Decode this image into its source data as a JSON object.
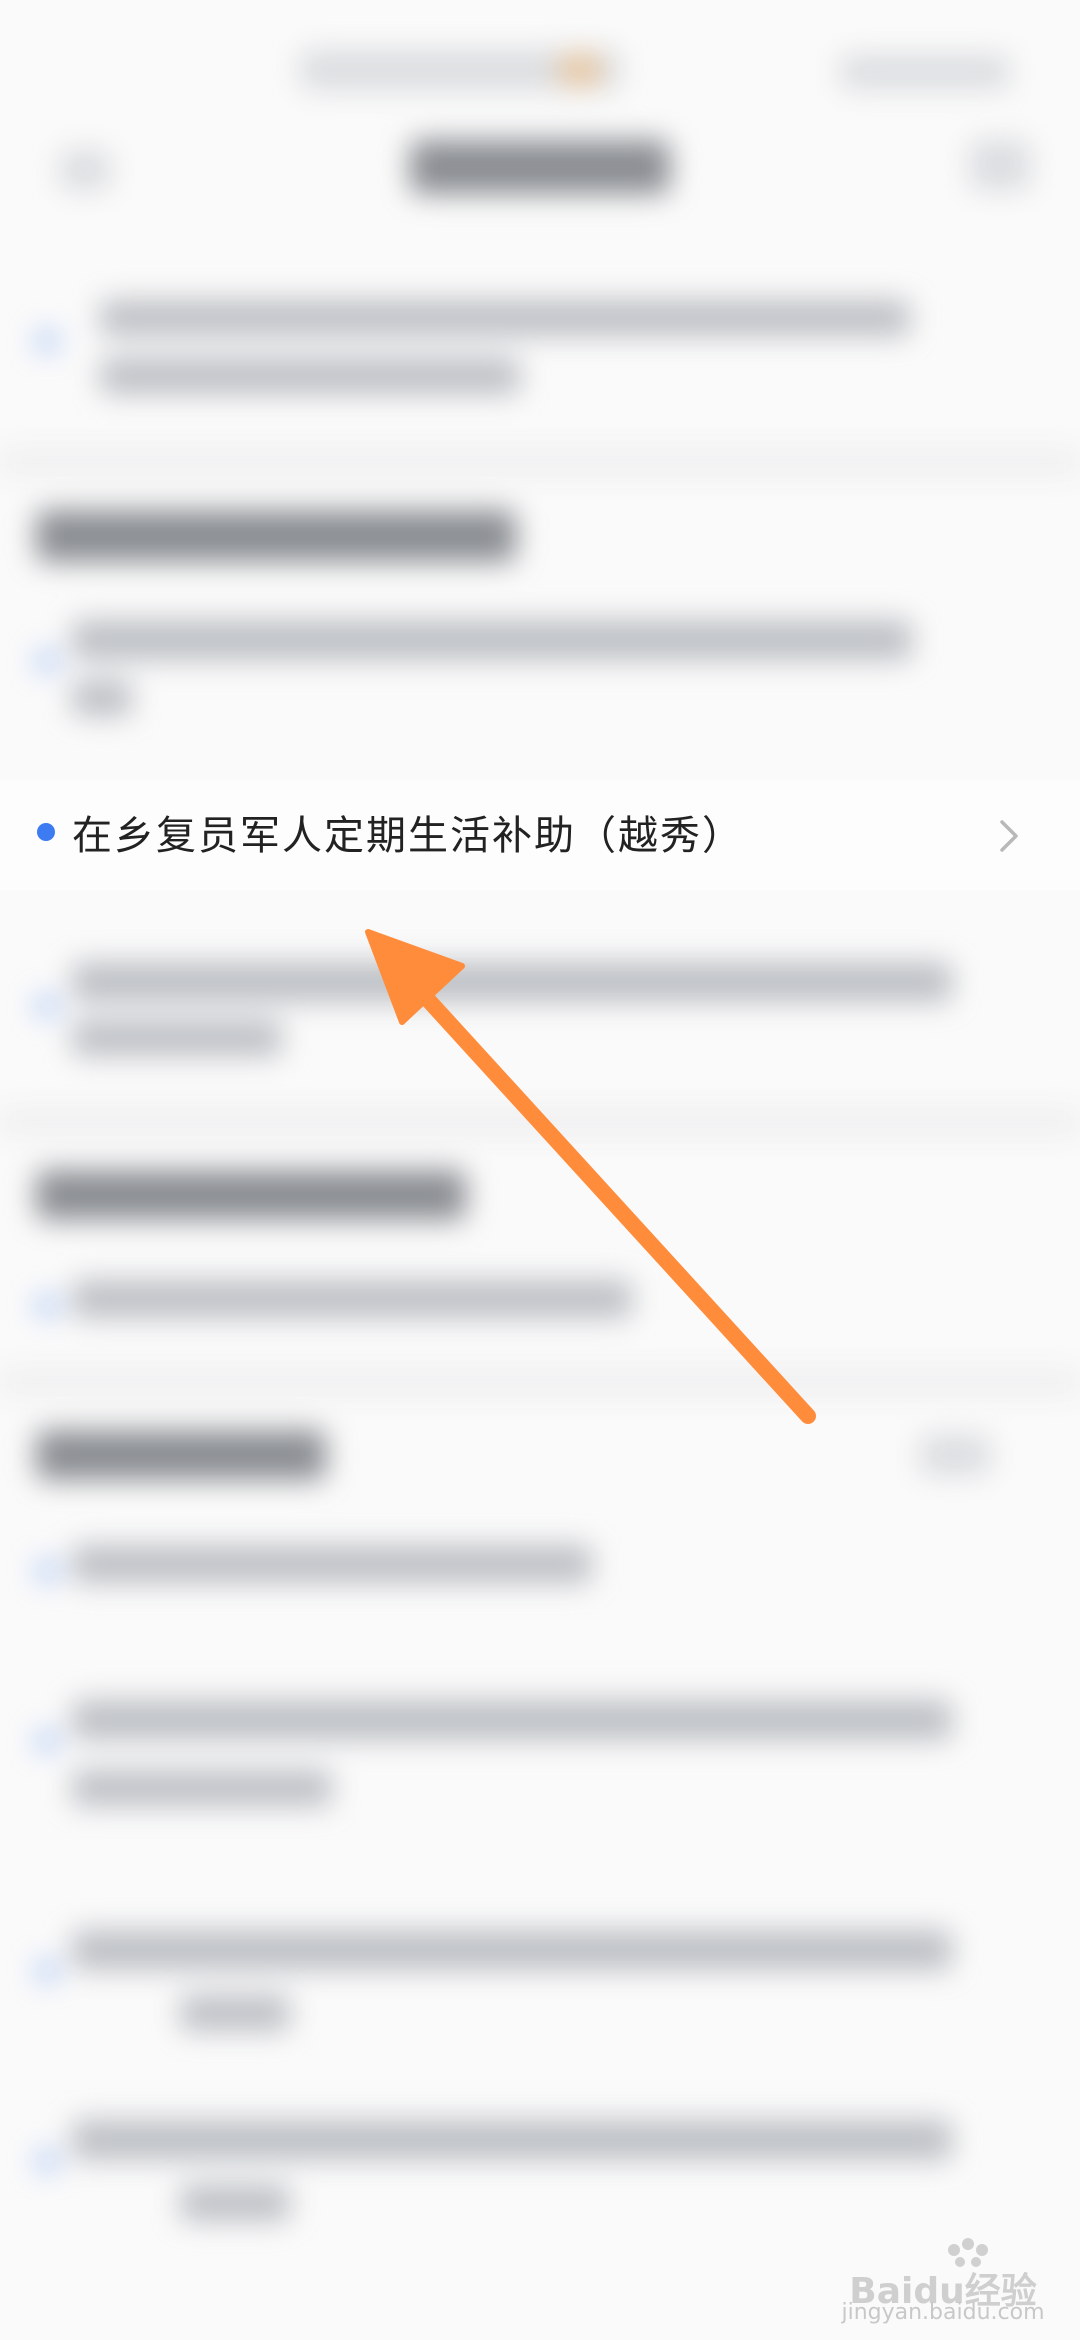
{
  "list_item": {
    "title": "在乡复员军人定期生活补助（越秀）"
  },
  "icons": {
    "bullet": "bullet-dot-icon",
    "chevron": "chevron-right-icon",
    "arrow": "annotation-arrow-icon"
  },
  "colors": {
    "accent_blue": "#3d7bf2",
    "arrow_orange": "#ff8c3a",
    "text_primary": "#222222"
  },
  "watermark": {
    "brand": "Baidu经验",
    "url": "jingyan.baidu.com"
  }
}
